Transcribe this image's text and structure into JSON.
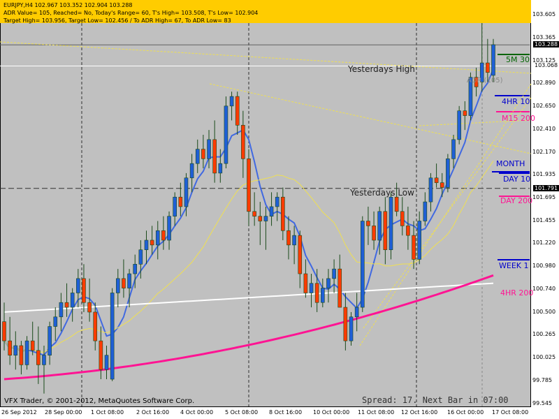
{
  "header": {
    "line1": "EURJPY,H4  102.967 103.352 102.904 103.288",
    "line2": "ADR Value= 105, Reached= No, Today's Range= 60, T's High= 103.508, T's Low= 102.904",
    "line3": "Target High= 103.956, Target Low= 102.456 / To ADR High= 67, To ADR Low= 83"
  },
  "footer": {
    "copyright": "VFX Trader, © 2001-2012, MetaQuotes Software Corp.",
    "status": "Spread: 17. Next Bar in 07:00"
  },
  "annotations": {
    "yesterdays_high": "Yesterdays High",
    "yesterdays_low": "Yesterdays Low",
    "adr": "ADR (105)"
  },
  "side_labels": [
    {
      "text": "5M 30",
      "color": "#006400"
    },
    {
      "text": "4HR 10",
      "color": "#0000cc"
    },
    {
      "text": "M15 200",
      "color": "#ff1493"
    },
    {
      "text": "MONTH",
      "color": "#0000cc"
    },
    {
      "text": "DAY 10",
      "color": "#0000cc"
    },
    {
      "text": "DAY 200",
      "color": "#ff1493"
    },
    {
      "text": "WEEK 1",
      "color": "#0000cc"
    },
    {
      "text": "4HR 200",
      "color": "#ff1493"
    }
  ],
  "chart_data": {
    "type": "candlestick",
    "symbol": "EURJPY",
    "timeframe": "H4",
    "ylim": [
      99.545,
      103.625
    ],
    "y_ticks": [
      103.605,
      103.365,
      103.125,
      102.89,
      102.65,
      102.41,
      102.17,
      101.935,
      101.695,
      101.455,
      101.22,
      100.98,
      100.74,
      100.5,
      100.265,
      100.025,
      99.785,
      99.545
    ],
    "x_ticks": [
      "26 Sep 2012",
      "28 Sep 00:00",
      "1 Oct 08:00",
      "2 Oct 16:00",
      "4 Oct 00:00",
      "5 Oct 08:00",
      "8 Oct 16:00",
      "10 Oct 00:00",
      "11 Oct 08:00",
      "12 Oct 16:00",
      "16 Oct 00:00",
      "17 Oct 08:00"
    ],
    "price_boxes": [
      {
        "value": "103.288",
        "bg": "#000000",
        "fg": "#ffffff"
      },
      {
        "value": "103.068",
        "bg": "#ffffff",
        "fg": "#000000"
      },
      {
        "value": "101.791",
        "bg": "#000000",
        "fg": "#ffffff"
      }
    ],
    "levels": {
      "yesterdays_high": 103.068,
      "yesterdays_low": 101.791,
      "last_price": 103.288
    },
    "colors": {
      "bull": "#1f5fd6",
      "bear": "#ff3b00",
      "ma_fast": "#4169e1",
      "ma_mid": "#f0e050",
      "ma_slow": "#ffffff",
      "ma_magenta": "#ff1493",
      "background": "#c0c0c0"
    },
    "candles": [
      [
        100.4,
        100.6,
        100.1,
        100.2
      ],
      [
        100.2,
        100.45,
        99.95,
        100.05
      ],
      [
        100.05,
        100.3,
        99.9,
        100.15
      ],
      [
        100.15,
        100.2,
        99.85,
        99.95
      ],
      [
        99.95,
        100.25,
        99.9,
        100.2
      ],
      [
        100.2,
        100.4,
        100.05,
        100.1
      ],
      [
        100.1,
        100.35,
        99.75,
        99.95
      ],
      [
        99.95,
        100.15,
        99.65,
        100.05
      ],
      [
        100.05,
        100.4,
        99.95,
        100.35
      ],
      [
        100.35,
        100.55,
        100.2,
        100.45
      ],
      [
        100.45,
        100.7,
        100.3,
        100.6
      ],
      [
        100.6,
        100.8,
        100.45,
        100.55
      ],
      [
        100.55,
        100.75,
        100.4,
        100.7
      ],
      [
        100.7,
        100.95,
        100.55,
        100.85
      ],
      [
        100.85,
        101.0,
        100.5,
        100.6
      ],
      [
        100.6,
        100.85,
        100.4,
        100.5
      ],
      [
        100.5,
        100.6,
        100.1,
        100.2
      ],
      [
        100.2,
        100.35,
        99.8,
        99.9
      ],
      [
        99.9,
        100.15,
        99.8,
        100.05
      ],
      [
        99.8,
        100.75,
        99.78,
        100.7
      ],
      [
        100.7,
        100.95,
        100.55,
        100.85
      ],
      [
        100.85,
        101.05,
        100.65,
        100.75
      ],
      [
        100.75,
        100.95,
        100.55,
        100.9
      ],
      [
        100.9,
        101.1,
        100.75,
        101.0
      ],
      [
        101.0,
        101.25,
        100.85,
        101.15
      ],
      [
        101.15,
        101.35,
        101.0,
        101.25
      ],
      [
        101.25,
        101.4,
        101.1,
        101.2
      ],
      [
        101.2,
        101.45,
        101.05,
        101.35
      ],
      [
        101.35,
        101.5,
        101.15,
        101.25
      ],
      [
        101.25,
        101.55,
        101.15,
        101.5
      ],
      [
        101.5,
        101.75,
        101.4,
        101.7
      ],
      [
        101.7,
        101.85,
        101.5,
        101.6
      ],
      [
        101.6,
        101.95,
        101.5,
        101.9
      ],
      [
        101.9,
        102.15,
        101.75,
        102.05
      ],
      [
        102.05,
        102.3,
        101.95,
        102.2
      ],
      [
        102.2,
        102.35,
        102.0,
        102.1
      ],
      [
        102.1,
        102.4,
        102.0,
        102.3
      ],
      [
        102.3,
        102.5,
        101.85,
        101.95
      ],
      [
        101.95,
        102.2,
        101.85,
        102.05
      ],
      [
        102.05,
        102.75,
        102.0,
        102.65
      ],
      [
        102.65,
        102.8,
        102.5,
        102.75
      ],
      [
        102.75,
        102.8,
        102.35,
        102.45
      ],
      [
        102.45,
        102.6,
        101.9,
        102.1
      ],
      [
        102.1,
        102.2,
        101.4,
        101.55
      ],
      [
        101.55,
        101.75,
        101.4,
        101.5
      ],
      [
        101.5,
        101.65,
        101.2,
        101.45
      ],
      [
        101.45,
        101.6,
        101.15,
        101.5
      ],
      [
        101.5,
        101.75,
        101.4,
        101.6
      ],
      [
        101.6,
        101.75,
        101.45,
        101.7
      ],
      [
        101.7,
        101.8,
        101.25,
        101.35
      ],
      [
        101.35,
        101.5,
        101.05,
        101.2
      ],
      [
        101.2,
        101.4,
        101.0,
        101.3
      ],
      [
        101.3,
        101.35,
        100.75,
        100.9
      ],
      [
        100.9,
        101.05,
        100.65,
        100.7
      ],
      [
        100.7,
        100.9,
        100.55,
        100.8
      ],
      [
        100.8,
        100.95,
        100.5,
        100.6
      ],
      [
        100.6,
        100.85,
        100.55,
        100.75
      ],
      [
        100.75,
        100.95,
        100.6,
        100.85
      ],
      [
        100.85,
        101.05,
        100.7,
        100.95
      ],
      [
        100.95,
        101.1,
        100.7,
        100.55
      ],
      [
        100.55,
        100.7,
        100.1,
        100.2
      ],
      [
        100.2,
        100.5,
        100.15,
        100.45
      ],
      [
        100.45,
        100.7,
        100.3,
        100.55
      ],
      [
        100.55,
        101.5,
        100.5,
        101.45
      ],
      [
        101.45,
        101.6,
        101.2,
        101.4
      ],
      [
        101.4,
        101.55,
        101.15,
        101.25
      ],
      [
        101.25,
        101.6,
        101.1,
        101.55
      ],
      [
        101.55,
        101.7,
        101.0,
        101.15
      ],
      [
        101.15,
        101.75,
        101.05,
        101.7
      ],
      [
        101.7,
        101.85,
        101.5,
        101.55
      ],
      [
        101.55,
        101.7,
        101.3,
        101.4
      ],
      [
        101.4,
        101.6,
        101.15,
        101.3
      ],
      [
        101.3,
        101.45,
        100.95,
        101.05
      ],
      [
        101.05,
        101.55,
        101.0,
        101.45
      ],
      [
        101.45,
        101.75,
        101.4,
        101.65
      ],
      [
        101.65,
        101.95,
        101.55,
        101.9
      ],
      [
        101.9,
        102.05,
        101.8,
        101.85
      ],
      [
        101.85,
        101.95,
        101.7,
        101.8
      ],
      [
        101.8,
        102.15,
        101.75,
        102.1
      ],
      [
        102.1,
        102.35,
        102.0,
        102.3
      ],
      [
        102.3,
        102.65,
        102.25,
        102.6
      ],
      [
        102.6,
        102.7,
        102.4,
        102.55
      ],
      [
        102.55,
        103.0,
        102.5,
        102.95
      ],
      [
        102.95,
        103.05,
        102.75,
        102.85
      ],
      [
        102.9,
        103.6,
        102.8,
        103.1
      ],
      [
        103.1,
        103.35,
        102.9,
        103.0
      ],
      [
        102.97,
        103.35,
        102.9,
        103.29
      ]
    ]
  }
}
